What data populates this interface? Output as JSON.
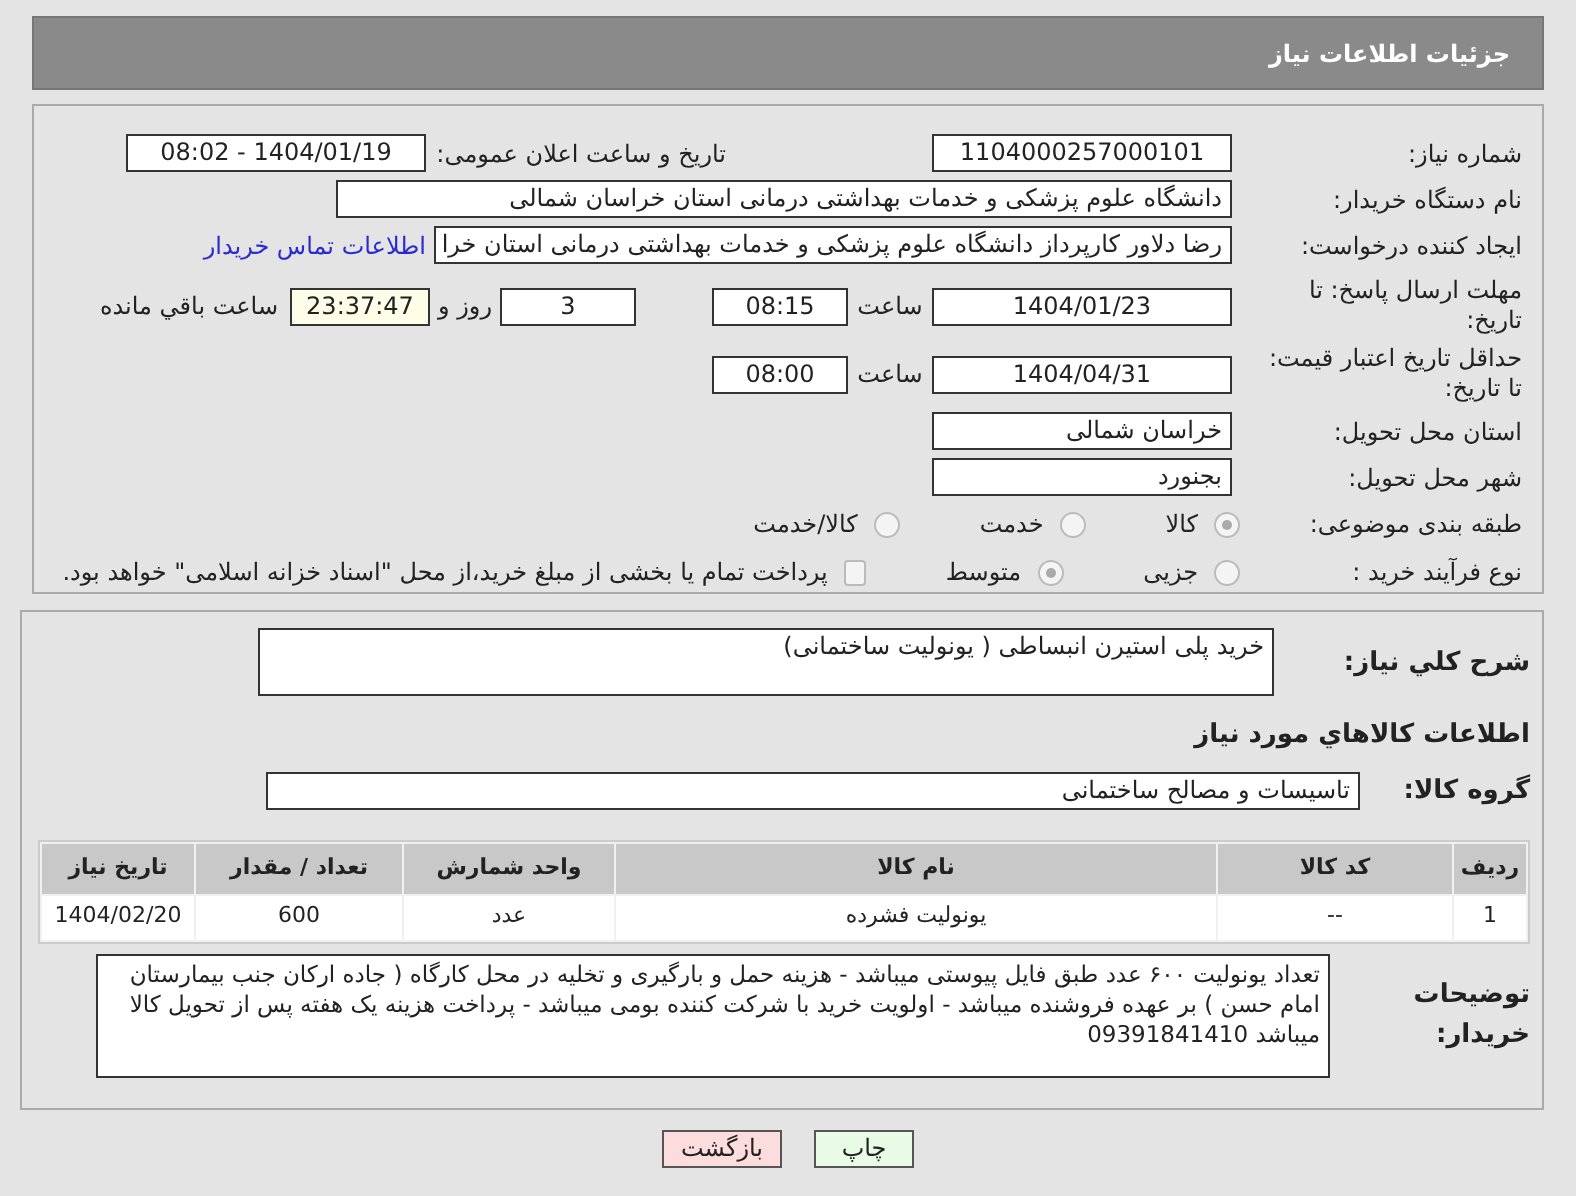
{
  "header": {
    "title": "جزئیات اطلاعات نیاز"
  },
  "need_number": {
    "label": "شماره نیاز:",
    "value": "1104000257000101"
  },
  "announce": {
    "label": "تاریخ و ساعت اعلان عمومی:",
    "value": "1404/01/19 - 08:02"
  },
  "buyer": {
    "label": "نام دستگاه خریدار:",
    "value": "دانشگاه علوم پزشکی و خدمات بهداشتی درمانی استان خراسان شمالی"
  },
  "creator": {
    "label": "ایجاد کننده درخواست:",
    "value": "رضا دلاور کارپرداز  دانشگاه علوم پزشکی و خدمات بهداشتی درمانی استان خرا",
    "link": "اطلاعات تماس خریدار"
  },
  "deadline": {
    "label": "مهلت ارسال پاسخ: تا تاریخ:",
    "date": "1404/01/23",
    "time_label": "ساعت",
    "time": "08:15",
    "days": "3",
    "days_label": "روز و",
    "remaining": "23:37:47",
    "remaining_label": "ساعت باقي مانده"
  },
  "validity": {
    "label": "حداقل تاریخ اعتبار قیمت: تا تاریخ:",
    "date": "1404/04/31",
    "time_label": "ساعت",
    "time": "08:00"
  },
  "province": {
    "label": "استان محل تحویل:",
    "value": "خراسان شمالی"
  },
  "city": {
    "label": "شهر محل تحویل:",
    "value": "بجنورد"
  },
  "category": {
    "label": "طبقه بندی موضوعی:",
    "options": [
      {
        "label": "کالا",
        "selected": true
      },
      {
        "label": "خدمت",
        "selected": false
      },
      {
        "label": "کالا/خدمت",
        "selected": false
      }
    ]
  },
  "process": {
    "label": "نوع فرآیند خرید :",
    "options": [
      {
        "label": "جزیی",
        "selected": false
      },
      {
        "label": "متوسط",
        "selected": true
      }
    ],
    "checkbox": {
      "label": "پرداخت تمام یا بخشی از مبلغ خرید،از محل \"اسناد خزانه اسلامی\" خواهد بود.",
      "checked": false
    }
  },
  "description": {
    "label": "شرح کلي نیاز:",
    "value": "خرید پلی استیرن انبساطی ( یونولیت ساختمانی)"
  },
  "goods_heading": "اطلاعات کالاهاي مورد نیاز",
  "goods_group": {
    "label": "گروه کالا:",
    "value": "تاسیسات و مصالح ساختمانی"
  },
  "table": {
    "columns": [
      "ردیف",
      "کد کالا",
      "نام کالا",
      "واحد شمارش",
      "تعداد / مقدار",
      "تاریخ نیاز"
    ],
    "rows": [
      [
        "1",
        "--",
        "یونولیت فشرده",
        "عدد",
        "600",
        "1404/02/20"
      ]
    ]
  },
  "buyer_notes": {
    "label": "توضیحات خریدار:",
    "value": "تعداد یونولیت ۶۰۰ عدد طبق فایل پیوستی میباشد - هزینه حمل و بارگیری و تخلیه در محل کارگاه ( جاده ارکان جنب بیمارستان امام حسن ) بر عهده فروشنده میباشد - اولویت خرید با شرکت کننده بومی میباشد - پرداخت هزینه یک هفته پس از تحویل کالا میباشد 09391841410"
  },
  "buttons": [
    {
      "label": "چاپ",
      "kind": "print"
    },
    {
      "label": "بازگشت",
      "kind": "back"
    }
  ]
}
